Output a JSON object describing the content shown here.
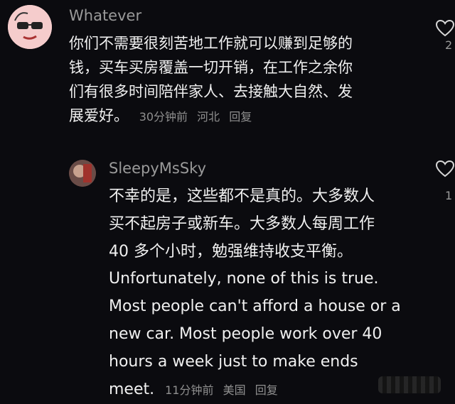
{
  "comments": [
    {
      "username": "Whatever",
      "body_lines": [
        "你们不需要很刻苦地工作就可以赚到足够的",
        "钱，买车买房覆盖一切开销，在工作之余你",
        "们有很多时间陪伴家人、去接触大自然、发",
        "展爱好。"
      ],
      "time": "30分钟前",
      "location": "河北",
      "reply_label": "回复",
      "like_count": "2"
    },
    {
      "username": "SleepyMsSky",
      "body_lines": [
        "不幸的是，这些都不是真的。大多数人",
        "买不起房子或新车。大多数人每周工作",
        "40 多个小时，勉强维持收支平衡。",
        "Unfortunately, none of this is true.",
        "Most people can't afford a house or a",
        "new car. Most people work over 40",
        "hours a week just to make ends",
        "meet."
      ],
      "time": "11分钟前",
      "location": "美国",
      "reply_label": "回复",
      "like_count": "1"
    }
  ],
  "icons": {
    "heart": "heart-outline-icon",
    "avatar1": "cartoon-face-avatar",
    "avatar2": "photo-avatar"
  },
  "colors": {
    "background": "#0b0b0f",
    "text": "#f0f0f0",
    "muted": "#8f8f8f"
  }
}
